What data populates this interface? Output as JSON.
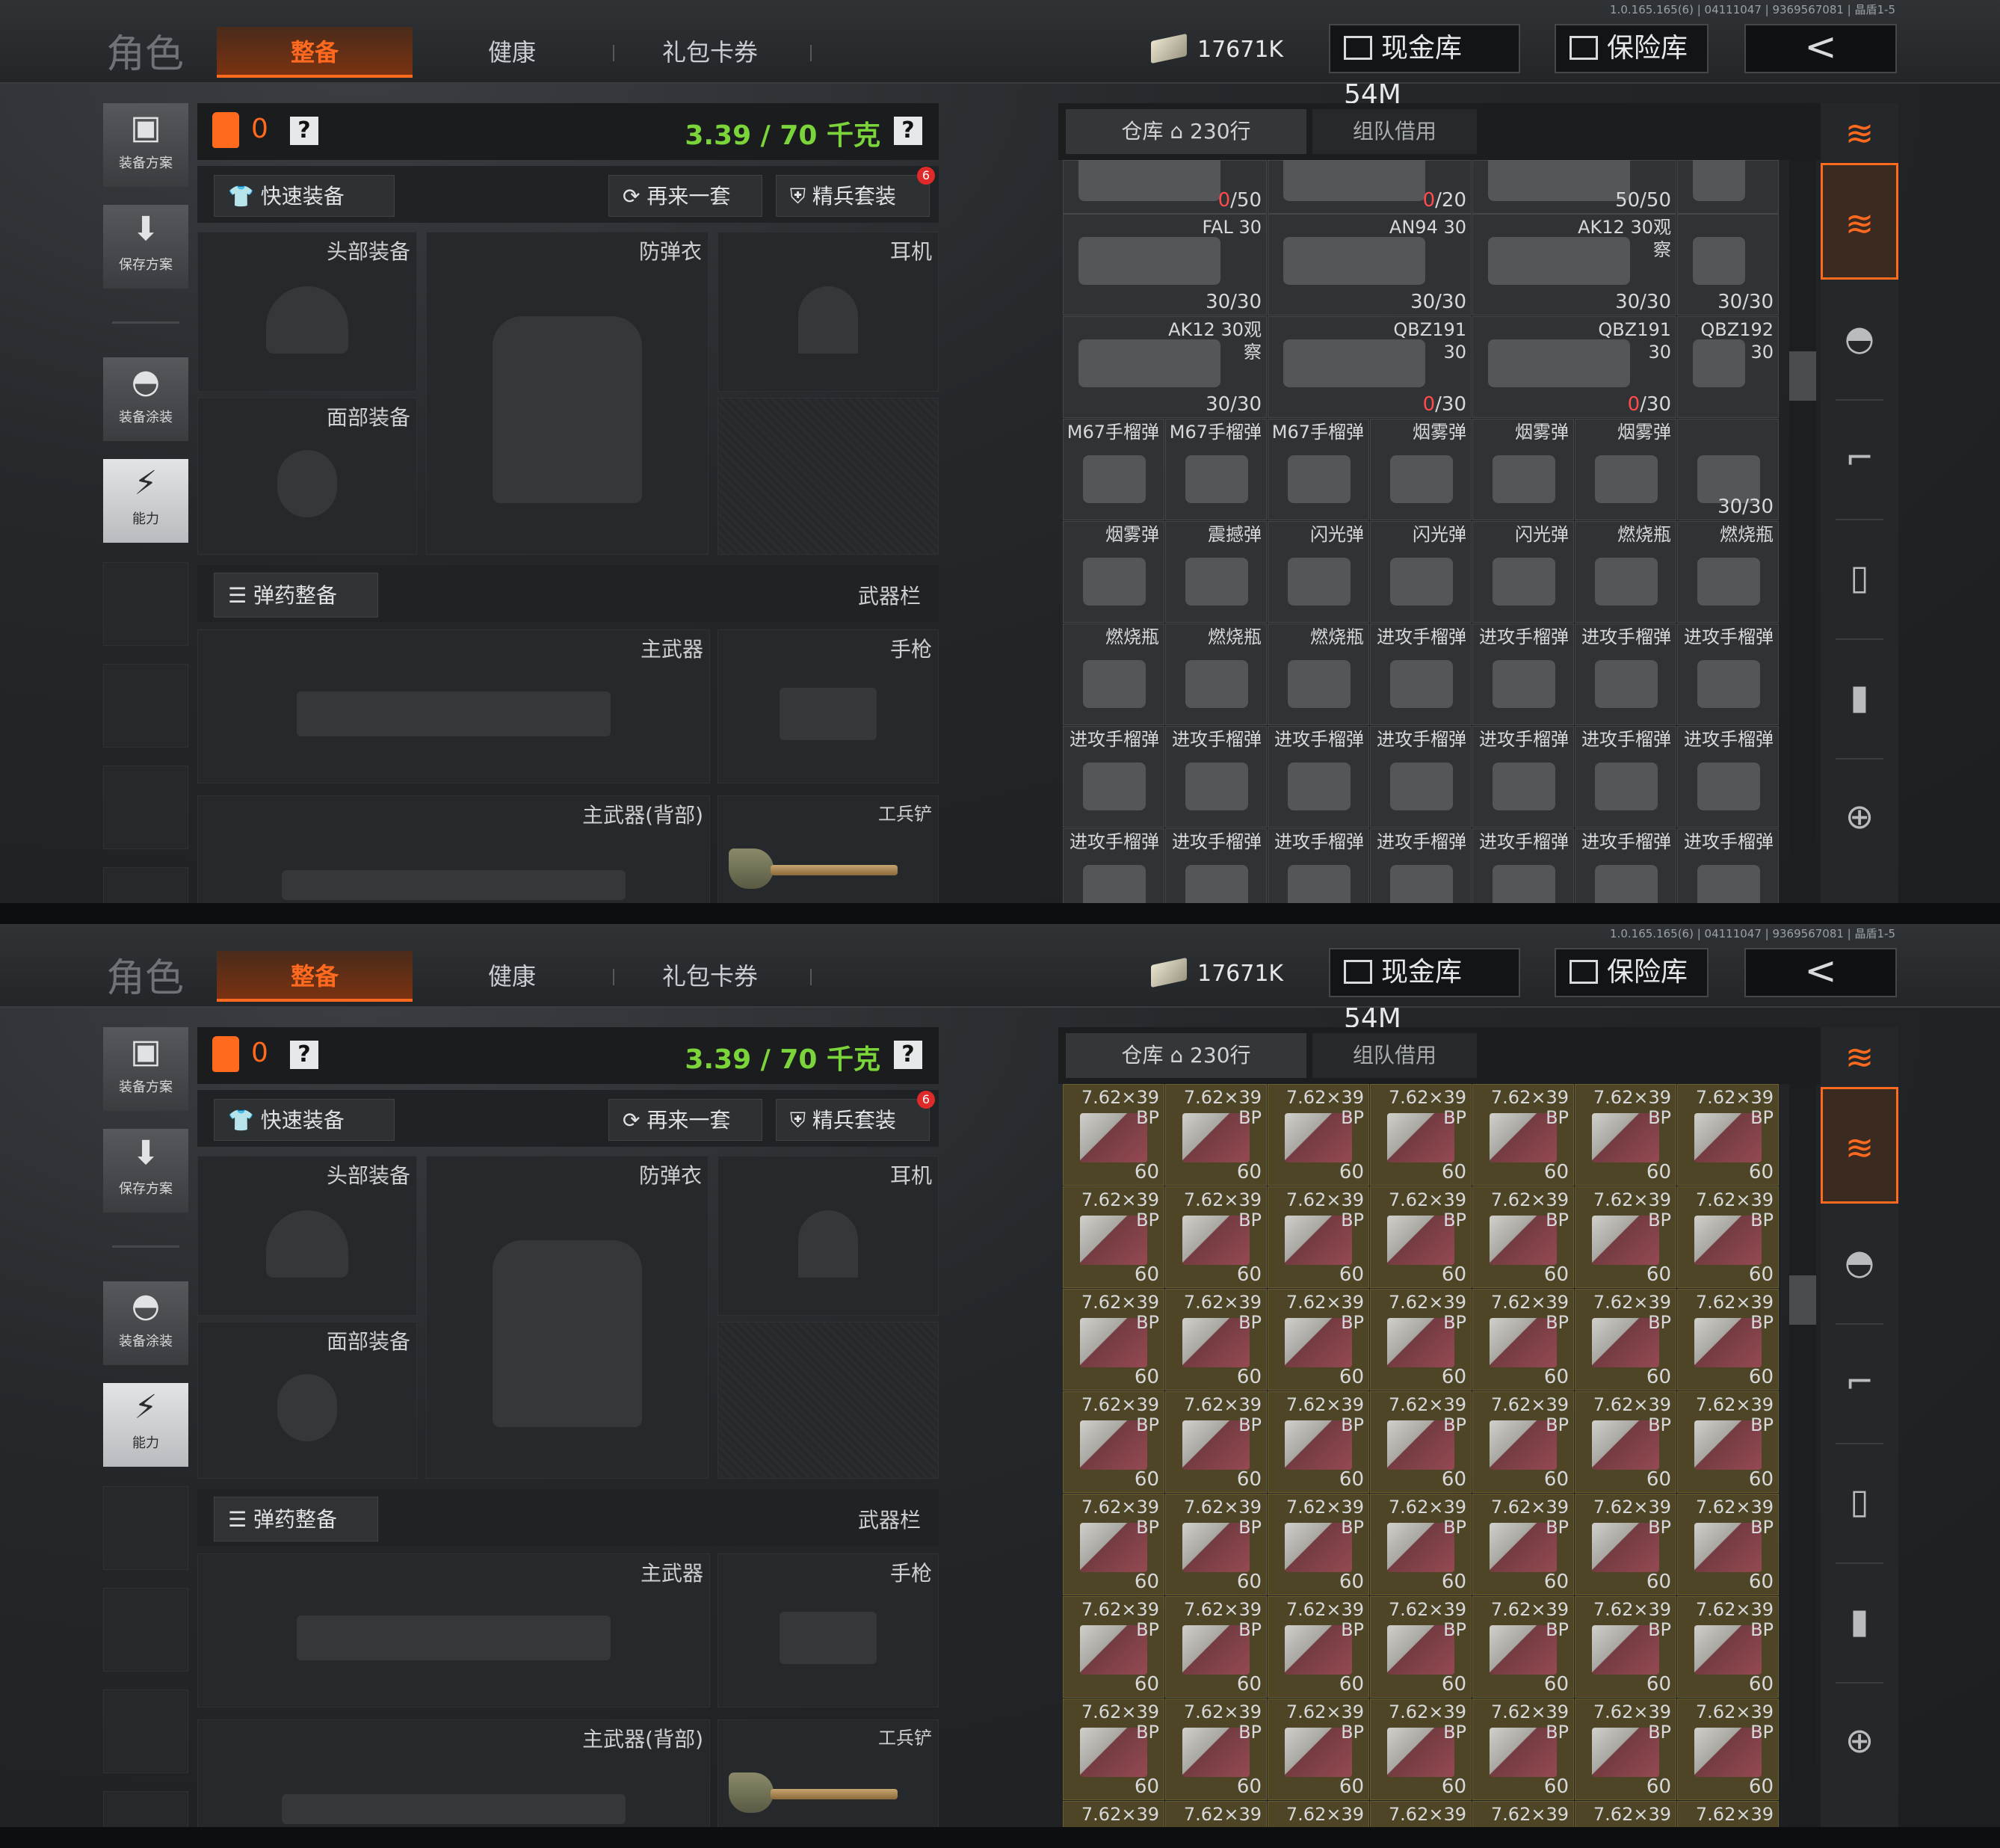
{
  "version": "1.0.165.165(6) | 04111047 | 9369567081 | 晶盾1-5",
  "header": {
    "title": "角色",
    "tabs": [
      "整备",
      "健康",
      "礼包卡券"
    ],
    "money": "17671K",
    "cash_vault": "现金库 54M",
    "safe": "保险库",
    "back": "<"
  },
  "rail": {
    "plan": "装备方案",
    "save": "保存方案",
    "paint": "装备涂装",
    "ability": "能力"
  },
  "loadout": {
    "count": "0",
    "help": "?",
    "weight": "3.39 / 70 千克",
    "quick": "快速装备",
    "again": "再来一套",
    "elite": "精兵套装",
    "elite_badge": "6",
    "head": "头部装备",
    "armor": "防弹衣",
    "headset": "耳机",
    "face": "面部装备",
    "ammo_btn": "弹药整备",
    "weapon_bar": "武器栏",
    "primary": "主武器",
    "pistol": "手枪",
    "primary_back": "主武器(背部)",
    "shovel": "工兵铲"
  },
  "inventory": {
    "tab_warehouse": "仓库 ⌂ 230行",
    "tab_team": "组队借用"
  },
  "grid_a": [
    [
      {
        "n": "",
        "c": "0/50",
        "r": "0"
      },
      {
        "n": "",
        "c": "0/20",
        "r": "0"
      },
      {
        "n": "",
        "c": "50/50"
      },
      {
        "n": "",
        "c": ""
      }
    ],
    [
      {
        "n": "FAL 30",
        "c": "30/30"
      },
      {
        "n": "AN94 30",
        "c": "30/30"
      },
      {
        "n": "AK12 30观察",
        "c": "30/30"
      },
      {
        "n": "",
        "c": "30/30"
      }
    ],
    [
      {
        "n": "AK12 30观察",
        "c": "30/30"
      },
      {
        "n": "QBZ191 30",
        "c": "0/30",
        "r": "0"
      },
      {
        "n": "QBZ191 30",
        "c": "0/30",
        "r": "0"
      },
      {
        "n": "QBZ192 30",
        "c": ""
      }
    ],
    [
      {
        "n": "M67手榴弹",
        "c": ""
      },
      {
        "n": "M67手榴弹",
        "c": ""
      },
      {
        "n": "M67手榴弹",
        "c": ""
      },
      {
        "n": "烟雾弹",
        "c": ""
      },
      {
        "n": "烟雾弹",
        "c": ""
      },
      {
        "n": "烟雾弹",
        "c": ""
      },
      {
        "n": "",
        "c": "30/30"
      }
    ],
    [
      {
        "n": "烟雾弹",
        "c": ""
      },
      {
        "n": "震撼弹",
        "c": ""
      },
      {
        "n": "闪光弹",
        "c": ""
      },
      {
        "n": "闪光弹",
        "c": ""
      },
      {
        "n": "闪光弹",
        "c": ""
      },
      {
        "n": "燃烧瓶",
        "c": ""
      },
      {
        "n": "燃烧瓶",
        "c": ""
      }
    ],
    [
      {
        "n": "燃烧瓶",
        "c": ""
      },
      {
        "n": "燃烧瓶",
        "c": ""
      },
      {
        "n": "燃烧瓶",
        "c": ""
      },
      {
        "n": "进攻手榴弹",
        "c": ""
      },
      {
        "n": "进攻手榴弹",
        "c": ""
      },
      {
        "n": "进攻手榴弹",
        "c": ""
      },
      {
        "n": "进攻手榴弹",
        "c": ""
      }
    ],
    [
      {
        "n": "进攻手榴弹",
        "c": ""
      },
      {
        "n": "进攻手榴弹",
        "c": ""
      },
      {
        "n": "进攻手榴弹",
        "c": ""
      },
      {
        "n": "进攻手榴弹",
        "c": ""
      },
      {
        "n": "进攻手榴弹",
        "c": ""
      },
      {
        "n": "进攻手榴弹",
        "c": ""
      },
      {
        "n": "进攻手榴弹",
        "c": ""
      }
    ],
    [
      {
        "n": "进攻手榴弹",
        "c": ""
      },
      {
        "n": "进攻手榴弹",
        "c": ""
      },
      {
        "n": "进攻手榴弹",
        "c": ""
      },
      {
        "n": "进攻手榴弹",
        "c": ""
      },
      {
        "n": "进攻手榴弹",
        "c": ""
      },
      {
        "n": "进攻手榴弹",
        "c": ""
      },
      {
        "n": "进攻手榴弹",
        "c": ""
      }
    ]
  ],
  "ammo_item": {
    "name": "7.62×39",
    "sub": "BP",
    "count": "60"
  },
  "colors": {
    "accent": "#ff6a1f",
    "weight": "#7bd43a",
    "ammo_bg": "#4e4526"
  },
  "icons": [
    "vest-icon",
    "download-icon",
    "helmet-icon",
    "lightning-icon",
    "ticket-icon",
    "vault-icon",
    "safe-icon",
    "back-arrow-icon",
    "stack-icon",
    "armor-cat-icon",
    "rifle-icon",
    "magazine-icon",
    "bullet-icon",
    "scope-icon"
  ]
}
